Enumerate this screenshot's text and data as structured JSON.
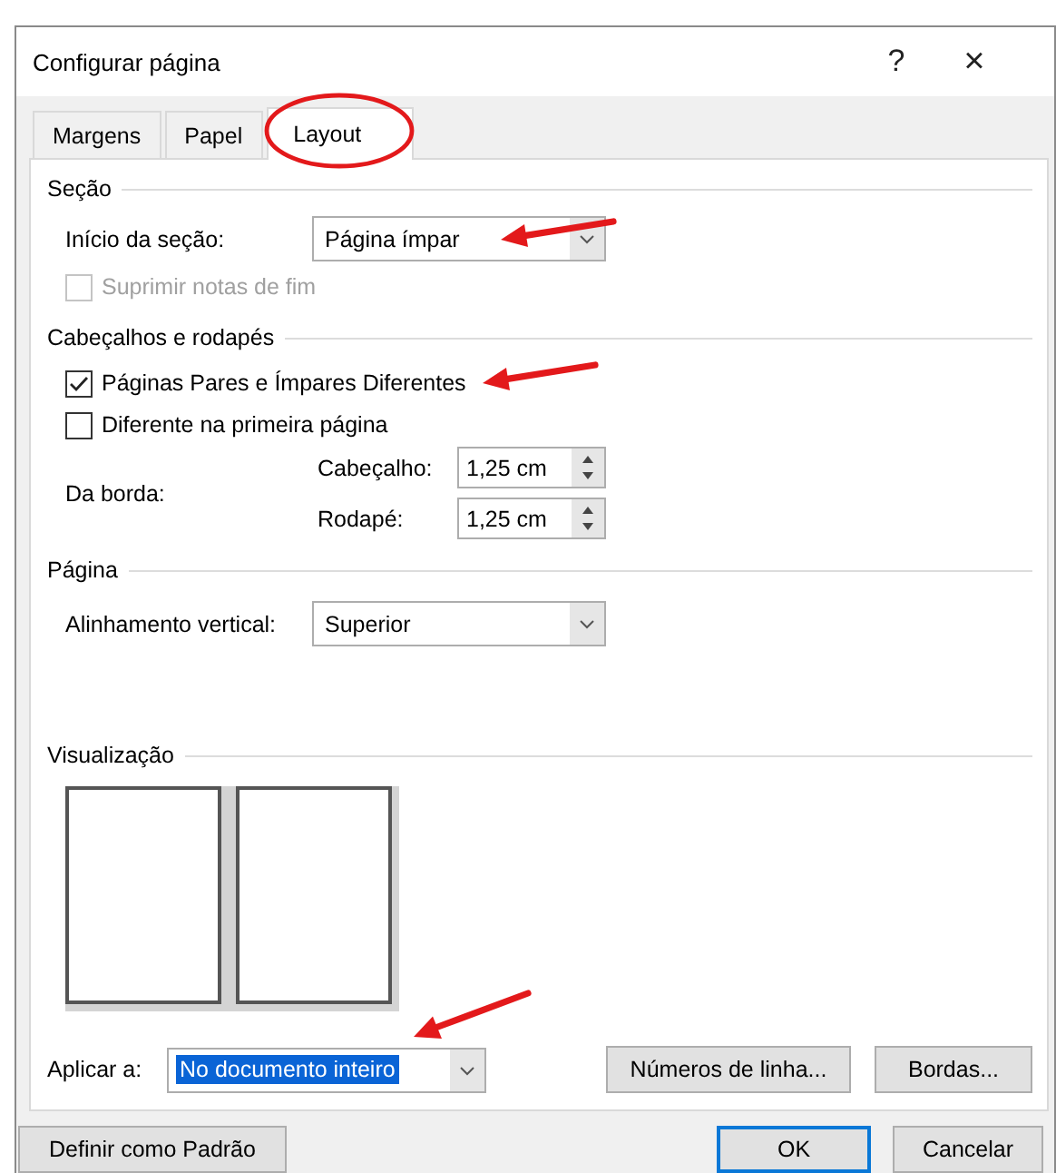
{
  "window": {
    "title": "Configurar página",
    "help_button": "?",
    "close_button": "×"
  },
  "tabs": [
    {
      "label": "Margens",
      "selected": false,
      "circled": false
    },
    {
      "label": "Papel",
      "selected": false,
      "circled": false
    },
    {
      "label": "Layout",
      "selected": true,
      "circled": true
    }
  ],
  "section": {
    "heading": "Seção",
    "start_label": "Início da seção:",
    "start_value": "Página ímpar",
    "start_arrowed": true,
    "suppress_endnotes": {
      "label": "Suprimir notas de fim",
      "checked": false,
      "disabled": true
    }
  },
  "headers_footers": {
    "heading": "Cabeçalhos e rodapés",
    "options": [
      {
        "label": "Páginas Pares e Ímpares Diferentes",
        "checked": true,
        "disabled": false,
        "arrowed": true
      },
      {
        "label": "Diferente na primeira página",
        "checked": false,
        "disabled": false,
        "arrowed": false
      }
    ],
    "from_edge_label": "Da borda:",
    "distances": [
      {
        "label": "Cabeçalho:",
        "value": "1,25 cm"
      },
      {
        "label": "Rodapé:",
        "value": "1,25 cm"
      }
    ]
  },
  "page": {
    "heading": "Página",
    "vertical_alignment_label": "Alinhamento vertical:",
    "vertical_alignment_value": "Superior"
  },
  "preview": {
    "heading": "Visualização"
  },
  "apply_to": {
    "label": "Aplicar a:",
    "value": "No documento inteiro",
    "arrowed": true
  },
  "panel_buttons": [
    "Números de linha...",
    "Bordas..."
  ],
  "footer_buttons": [
    {
      "label": "Definir como Padrão",
      "default": false
    },
    {
      "label": "OK",
      "default": true
    },
    {
      "label": "Cancelar",
      "default": false
    }
  ]
}
